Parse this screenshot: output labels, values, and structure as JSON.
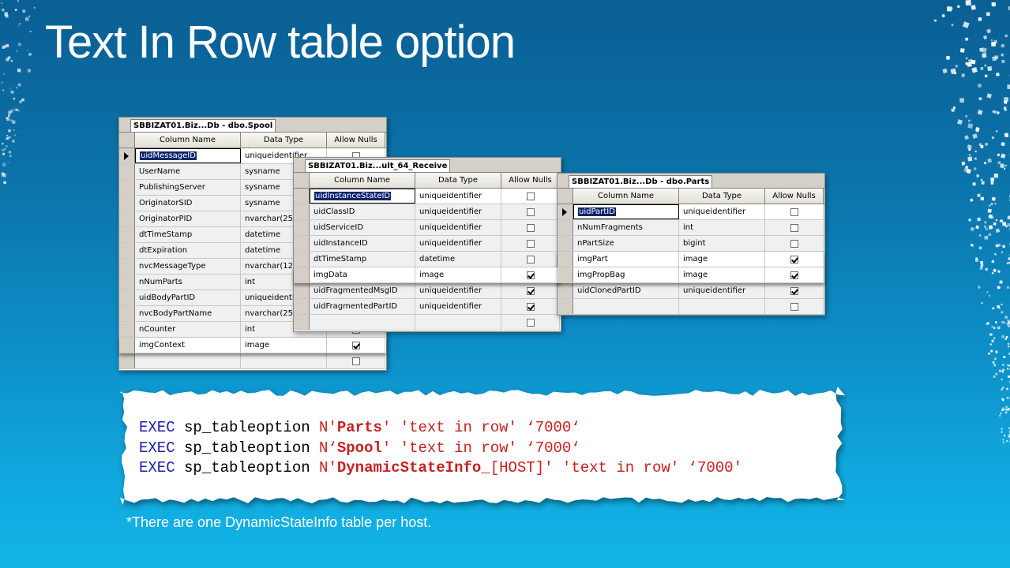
{
  "slide": {
    "title": "Text In Row table option",
    "footnote": "*There are one DynamicStateInfo table per host."
  },
  "columns_header": {
    "name": "Column Name",
    "type": "Data Type",
    "nulls": "Allow Nulls"
  },
  "tables": [
    {
      "tab": "SBBIZAT01.Biz...Db - dbo.Spool",
      "rows": [
        {
          "name": "uidMessageID",
          "type": "uniqueidentifier",
          "nulls": false,
          "editing": true,
          "current": true
        },
        {
          "name": "UserName",
          "type": "sysname",
          "nulls": false
        },
        {
          "name": "PublishingServer",
          "type": "sysname",
          "nulls": false
        },
        {
          "name": "OriginatorSID",
          "type": "sysname",
          "nulls": false
        },
        {
          "name": "OriginatorPID",
          "type": "nvarchar(25",
          "nulls": false
        },
        {
          "name": "dtTimeStamp",
          "type": "datetime",
          "nulls": false
        },
        {
          "name": "dtExpiration",
          "type": "datetime",
          "nulls": false
        },
        {
          "name": "nvcMessageType",
          "type": "nvarchar(12",
          "nulls": false
        },
        {
          "name": "nNumParts",
          "type": "int",
          "nulls": false
        },
        {
          "name": "uidBodyPartID",
          "type": "uniqueidenti",
          "nulls": false
        },
        {
          "name": "nvcBodyPartName",
          "type": "nvarchar(25",
          "nulls": false
        },
        {
          "name": "nCounter",
          "type": "int",
          "nulls": false
        },
        {
          "name": "imgContext",
          "type": "image",
          "nulls": true,
          "highlight": true
        },
        {
          "name": "",
          "type": "",
          "nulls": false
        }
      ]
    },
    {
      "tab": "SBBIZAT01.Biz...ult_64_Receive",
      "rows": [
        {
          "name": "uidInstanceStateID",
          "type": "uniqueidentifier",
          "nulls": false,
          "editing": true
        },
        {
          "name": "uidClassID",
          "type": "uniqueidentifier",
          "nulls": false
        },
        {
          "name": "uidServiceID",
          "type": "uniqueidentifier",
          "nulls": false
        },
        {
          "name": "uidInstanceID",
          "type": "uniqueidentifier",
          "nulls": false
        },
        {
          "name": "dtTimeStamp",
          "type": "datetime",
          "nulls": false
        },
        {
          "name": "imgData",
          "type": "image",
          "nulls": true,
          "highlight": true
        },
        {
          "name": "uidFragmentedMsgID",
          "type": "uniqueidentifier",
          "nulls": true
        },
        {
          "name": "uidFragmentedPartID",
          "type": "uniqueidentifier",
          "nulls": true
        },
        {
          "name": "",
          "type": "",
          "nulls": false
        }
      ]
    },
    {
      "tab": "SBBIZAT01.Biz...Db - dbo.Parts",
      "rows": [
        {
          "name": "uidPartID",
          "type": "uniqueidentifier",
          "nulls": false,
          "editing": true,
          "current": true
        },
        {
          "name": "nNumFragments",
          "type": "int",
          "nulls": false
        },
        {
          "name": "nPartSize",
          "type": "bigint",
          "nulls": false
        },
        {
          "name": "imgPart",
          "type": "image",
          "nulls": true,
          "highlight": true
        },
        {
          "name": "imgPropBag",
          "type": "image",
          "nulls": true,
          "highlight": true
        },
        {
          "name": "uidClonedPartID",
          "type": "uniqueidentifier",
          "nulls": true
        },
        {
          "name": "",
          "type": "",
          "nulls": false
        }
      ]
    }
  ],
  "code": {
    "line1": {
      "exec": "EXEC",
      "proc": " sp_tableoption ",
      "pre": "N'",
      "table": "Parts",
      "post": "' 'text in row' ‘7000‘"
    },
    "line2": {
      "exec": "EXEC",
      "proc": " sp_tableoption ",
      "pre": "N‘",
      "table": "Spool",
      "post": "' 'text in row' ‘7000‘"
    },
    "line3": {
      "exec": "EXEC",
      "proc": " sp_tableoption ",
      "pre": "N'",
      "table": "DynamicStateInfo_",
      "suffix": "[HOST]",
      "post": "' 'text in row' ‘7000'"
    }
  }
}
